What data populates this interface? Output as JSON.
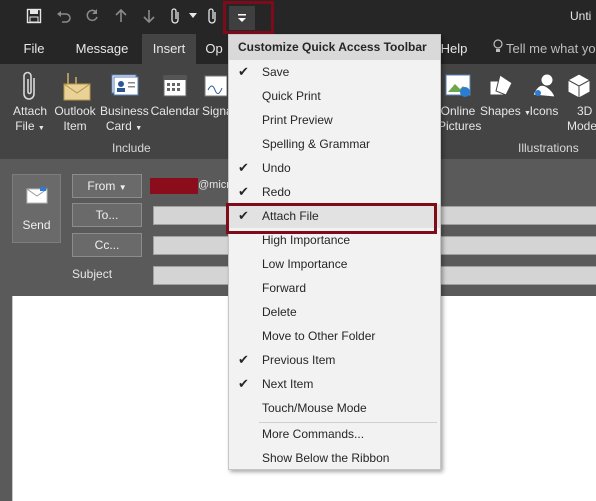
{
  "window": {
    "title": "Unti"
  },
  "qat": {
    "items": [
      {
        "name": "save-icon"
      },
      {
        "name": "undo-icon"
      },
      {
        "name": "redo-icon"
      },
      {
        "name": "previous-item-icon"
      },
      {
        "name": "next-item-icon"
      },
      {
        "name": "attach-file-icon"
      },
      {
        "name": "attach-file-icon"
      },
      {
        "name": "customize-qat-icon"
      }
    ]
  },
  "tabs": [
    "File",
    "Message",
    "Insert",
    "Op",
    "Help"
  ],
  "tell_me": "Tell me what yo",
  "ribbon": {
    "include_label": "Include",
    "illustrations_label": "Illustrations",
    "attach_file": [
      "Attach",
      "File"
    ],
    "outlook_item": [
      "Outlook",
      "Item"
    ],
    "business_card": [
      "Business",
      "Card"
    ],
    "calendar": [
      "Calendar"
    ],
    "signature": [
      "Signa"
    ],
    "online_pictures": [
      "Online",
      "Pictures"
    ],
    "shapes": [
      "Shapes"
    ],
    "icons": [
      "Icons"
    ],
    "models_3d": [
      "3D",
      "Mode"
    ]
  },
  "compose": {
    "send": "Send",
    "from": "From",
    "from_address": "@micr",
    "to": "To...",
    "cc": "Cc...",
    "subject": "Subject"
  },
  "menu": {
    "header": "Customize Quick Access Toolbar",
    "items": [
      {
        "label": "Save",
        "checked": true
      },
      {
        "label": "Quick Print",
        "checked": false
      },
      {
        "label": "Print Preview",
        "checked": false
      },
      {
        "label": "Spelling & Grammar",
        "checked": false
      },
      {
        "label": "Undo",
        "checked": true
      },
      {
        "label": "Redo",
        "checked": true
      },
      {
        "label": "Attach File",
        "checked": true
      },
      {
        "label": "High Importance",
        "checked": false
      },
      {
        "label": "Low Importance",
        "checked": false
      },
      {
        "label": "Forward",
        "checked": false
      },
      {
        "label": "Delete",
        "checked": false
      },
      {
        "label": "Move to Other Folder",
        "checked": false
      },
      {
        "label": "Previous Item",
        "checked": true
      },
      {
        "label": "Next Item",
        "checked": true
      },
      {
        "label": "Touch/Mouse Mode",
        "checked": false
      }
    ],
    "more_commands": "More Commands...",
    "show_below": "Show Below the Ribbon"
  },
  "colors": {
    "highlight": "#7d0b1a",
    "redacted": "#8b0d1c"
  }
}
